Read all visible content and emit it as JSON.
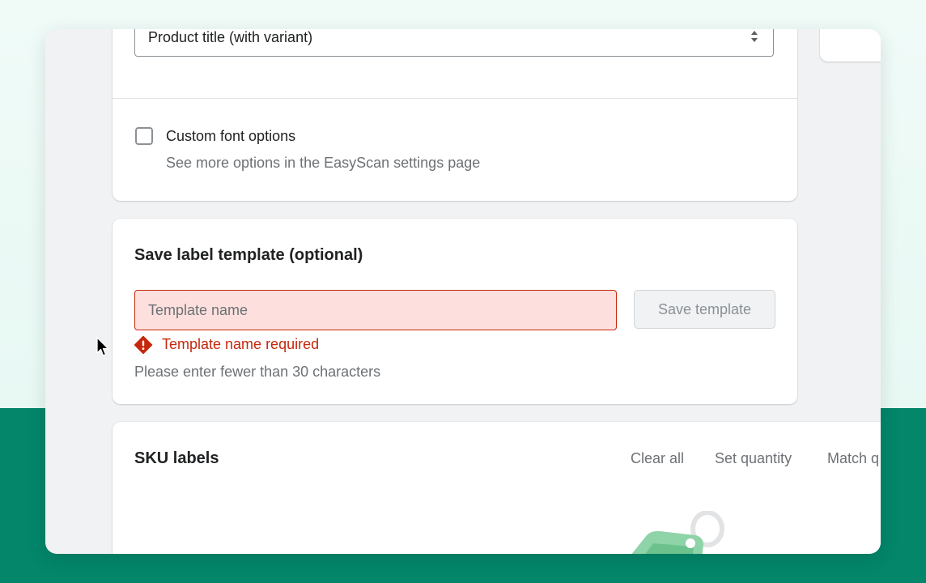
{
  "product_title_select": {
    "value": "Product title (with variant)"
  },
  "custom_font": {
    "label": "Custom font options",
    "help": "See more options in the EasyScan settings page",
    "checked": false
  },
  "save_template": {
    "heading": "Save label template (optional)",
    "input_placeholder": "Template name",
    "input_value": "",
    "button_label": "Save template",
    "error": "Template name required",
    "help": "Please enter fewer than 30 characters"
  },
  "sku_labels": {
    "heading": "SKU labels",
    "actions": [
      "Clear all",
      "Set quantity",
      "Match q"
    ]
  },
  "colors": {
    "error": "#c5280c",
    "error_bg": "#fde0dd",
    "brand_green": "#03866a"
  }
}
